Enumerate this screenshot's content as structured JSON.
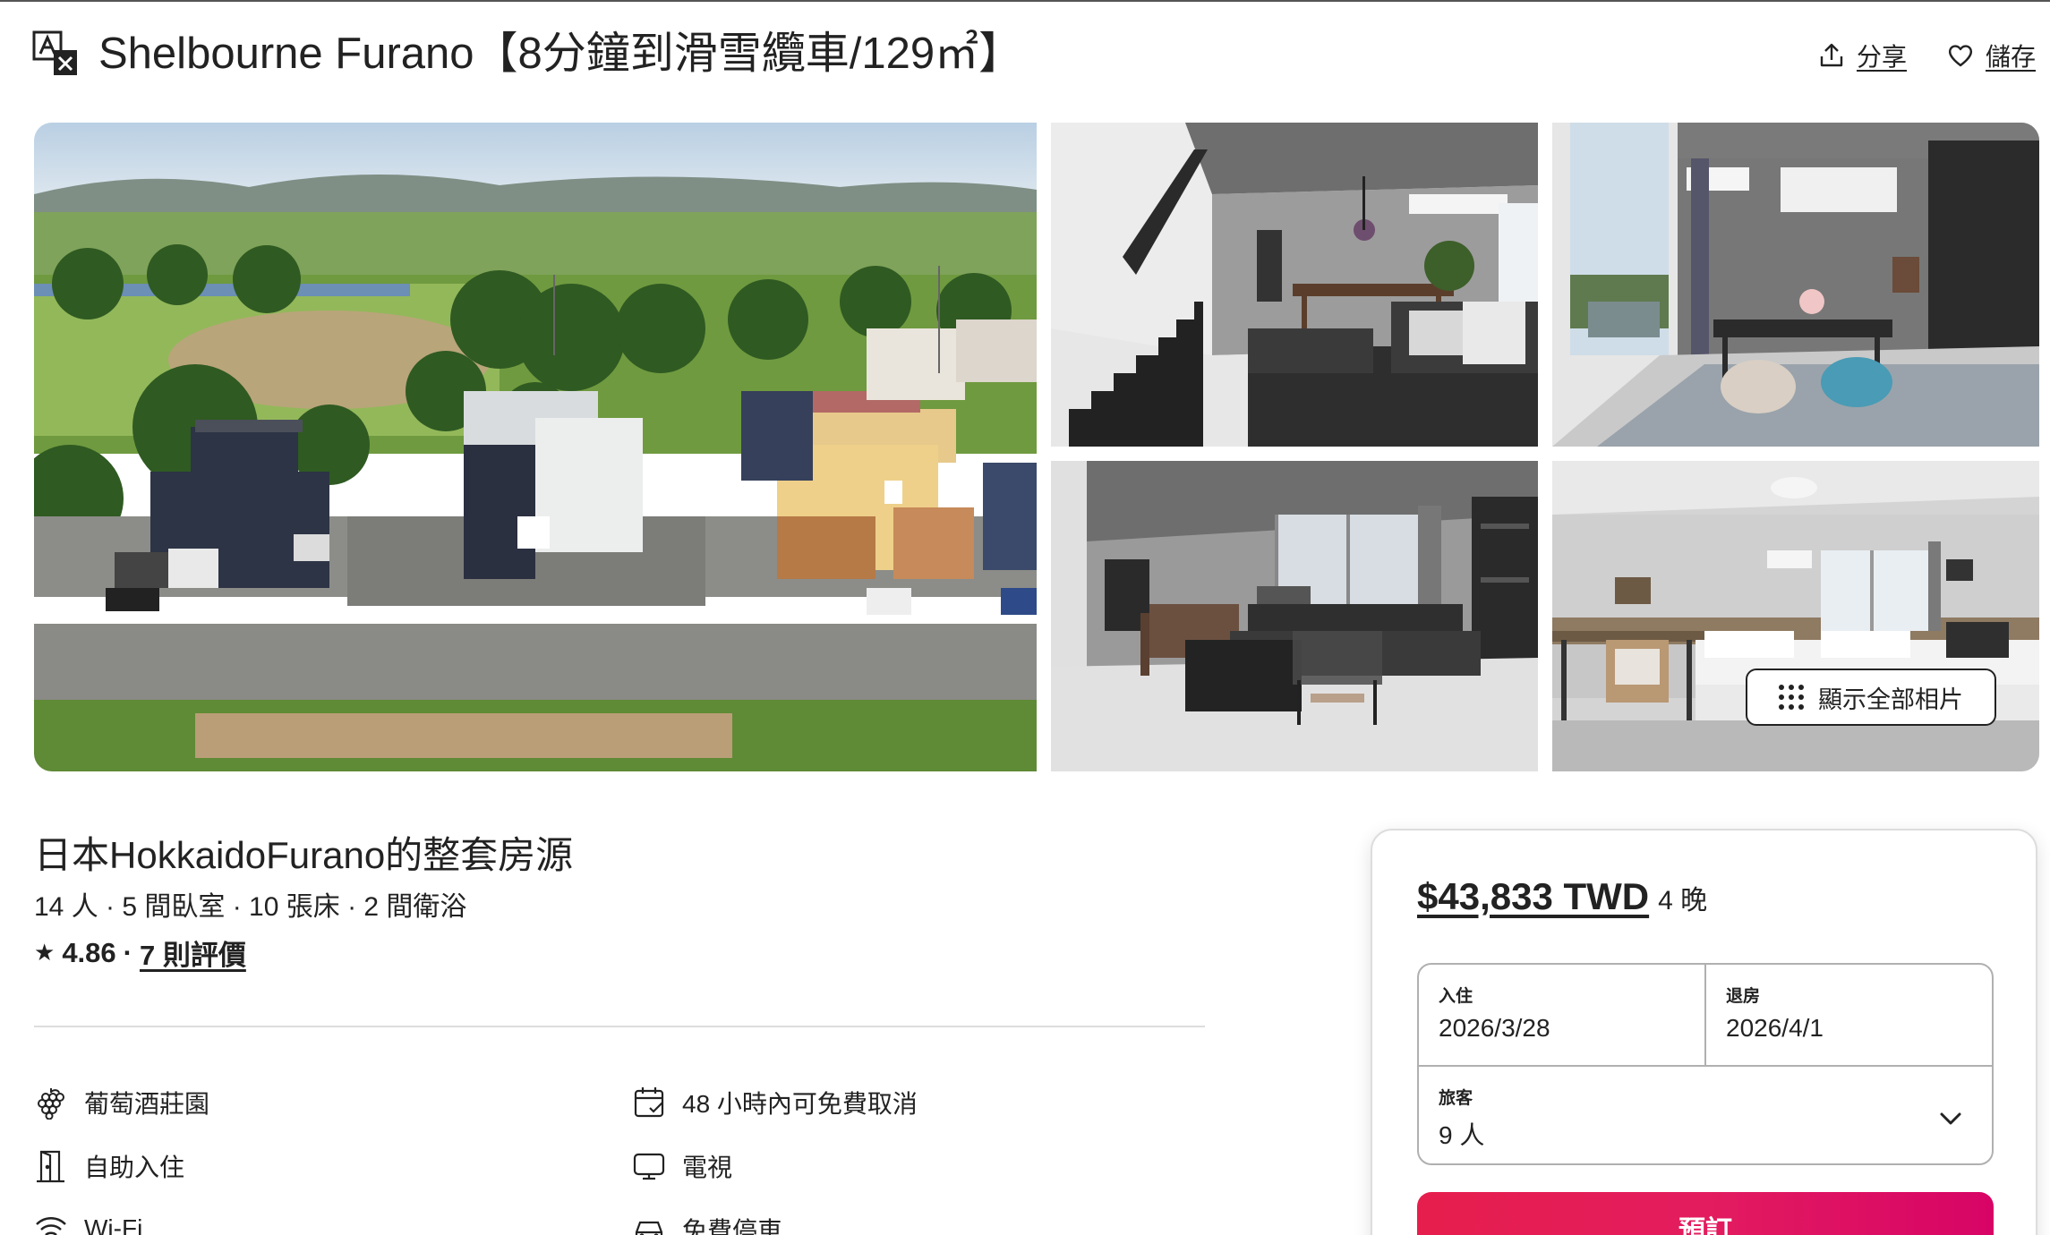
{
  "header": {
    "title": "Shelbourne Furano【8分鐘到滑雪纜車/129㎡】",
    "share_label": "分享",
    "save_label": "儲存"
  },
  "gallery": {
    "show_all_label": "顯示全部相片"
  },
  "listing": {
    "heading": "日本HokkaidoFurano的整套房源",
    "details": "14 人 · 5 間臥室 · 10 張床 · 2 間衛浴",
    "rating": "4.86",
    "rating_separator": "·",
    "reviews_link": "7 則評價"
  },
  "amenities": [
    {
      "label": "葡萄酒莊園",
      "icon": "grapes-icon"
    },
    {
      "label": "48 小時內可免費取消",
      "icon": "calendar-icon"
    },
    {
      "label": "自助入住",
      "icon": "door-icon"
    },
    {
      "label": "電視",
      "icon": "tv-icon"
    },
    {
      "label": "Wi-Fi",
      "icon": "wifi-icon"
    },
    {
      "label": "免費停車",
      "icon": "car-icon"
    }
  ],
  "booking": {
    "price": "$43,833 TWD",
    "nights": "4 晚",
    "checkin_caption": "入住",
    "checkin_value": "2026/3/28",
    "checkout_caption": "退房",
    "checkout_value": "2026/4/1",
    "guests_caption": "旅客",
    "guests_value": "9 人",
    "reserve_label": "預訂"
  },
  "colors": {
    "accent": "#e31c5f",
    "text": "#222222",
    "border": "#b0b0b0"
  }
}
